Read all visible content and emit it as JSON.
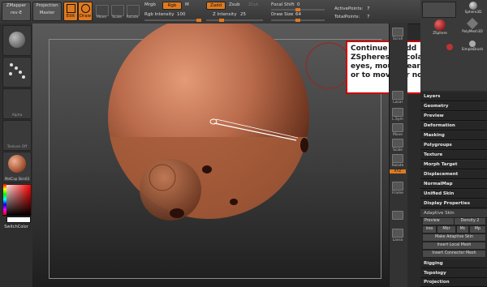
{
  "app": {
    "name": "ZBrush"
  },
  "topbar": {
    "zmapper": "ZMapper",
    "zmapper_sub": "rev-E",
    "projection_master": "Projection Master",
    "edit": "Edit",
    "draw": "Draw",
    "move": "Move",
    "scale": "Scale",
    "rotate": "Rotate",
    "mrgb": "Mrgb",
    "rgb": "Rgb",
    "m": "M",
    "rgb_intensity_label": "Rgb  Intensity",
    "rgb_intensity_value": "100",
    "zadd": "Zadd",
    "zsub": "Zsub",
    "zcut": "Zcut",
    "z_intensity_label": "Z Intensity",
    "z_intensity_value": "25",
    "focal_shift_label": "Focal Shift",
    "focal_shift_value": "0",
    "draw_size_label": "Draw Size",
    "draw_size_value": "64",
    "active_points_label": "ActivePoints:",
    "active_points_value": "7",
    "total_points_label": "TotalPoints:",
    "total_points_value": "7",
    "rgb_intensity_level": 1.0,
    "z_intensity_level": 0.25,
    "focal_shift_level": 0.5,
    "draw_size_level": 0.5
  },
  "leftshelf": {
    "material_caption": "",
    "alpha_caption": "Alpha",
    "texture_caption": "Texture Off",
    "matcap_caption": "MatCap Skin03",
    "switch_color": "SwitchColor"
  },
  "callout": {
    "text": "Continue to add ZSpheres, to colapse for eyes, mouth, ears holes or to move for nose."
  },
  "right_tools": [
    {
      "name": "scroll",
      "label": "Scroll"
    },
    {
      "name": "local",
      "label": "Local"
    },
    {
      "name": "lsym",
      "label": "L.Sym"
    },
    {
      "name": "move",
      "label": "Move"
    },
    {
      "name": "scale",
      "label": "Scale"
    },
    {
      "name": "rotate",
      "label": "Rotate"
    },
    {
      "name": "xyz",
      "label": "XYZ"
    },
    {
      "name": "frame",
      "label": "Frame"
    },
    {
      "name": "transp",
      "label": ""
    },
    {
      "name": "lasso",
      "label": "Lasso"
    }
  ],
  "tool_thumbs": {
    "sphere3d": "Sphere3D",
    "zsphere": "ZSphere",
    "polymesh3d": "PolyMesh3D",
    "simplebrush": "SimpleBrush"
  },
  "menu": {
    "layers": "Layers",
    "geometry": "Geometry",
    "preview": "Preview",
    "deformation": "Deformation",
    "masking": "Masking",
    "polygroups": "Polygroups",
    "texture": "Texture",
    "morph_target": "Morph Target",
    "displacement": "Displacement",
    "normalmap": "NormalMap",
    "unified_skin": "Unified Skin",
    "display_properties": "Display Properties",
    "adaptive_skin": "Adaptive Skin",
    "preview_btn": "Preview",
    "density_label": "Density",
    "density_value": "2",
    "ires": "ires",
    "mbr": "Mbr",
    "mc": "Mc",
    "mp": "Mp",
    "make_adaptive_skin": "Make Adaptive Skin",
    "insert_local_mesh": "Insert Local Mesh",
    "insert_connector_mesh": "Insert Connector Mesh",
    "rigging": "Rigging",
    "topology": "Topology",
    "projection": "Projection"
  },
  "colors": {
    "accent": "#e07a1f",
    "callout_border": "#cc0000",
    "sphere": "#b86a4a"
  }
}
